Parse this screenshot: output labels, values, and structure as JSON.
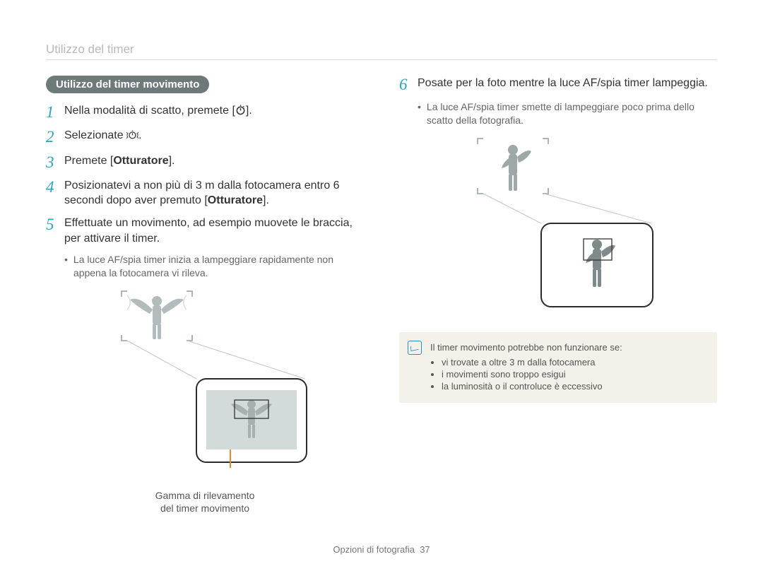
{
  "header": {
    "title": "Utilizzo del timer"
  },
  "left": {
    "pill": "Utilizzo del timer movimento",
    "steps": [
      {
        "num": "1",
        "html": "Nella modalità di scatto, premete [$TIMER$]."
      },
      {
        "num": "2",
        "html": "Selezionate $MOTION$."
      },
      {
        "num": "3",
        "html": "Premete [<b>Otturatore</b>]."
      },
      {
        "num": "4",
        "html": "Posizionatevi a non più di 3 m dalla fotocamera entro 6 secondi dopo aver premuto [<b>Otturatore</b>]."
      },
      {
        "num": "5",
        "html": "Effettuate un movimento, ad esempio muovete le braccia, per attivare il timer."
      }
    ],
    "sub_bullet_5": "La luce AF/spia timer inizia a lampeggiare rapidamente non appena la fotocamera vi rileva.",
    "caption_line1": "Gamma di rilevamento",
    "caption_line2": "del timer movimento"
  },
  "right": {
    "step6_num": "6",
    "step6_text": "Posate per la foto mentre la luce AF/spia timer lampeggia.",
    "sub_bullet_6": "La luce AF/spia timer smette di lampeggiare poco prima dello scatto della fotografia.",
    "note_title": "Il timer movimento potrebbe non funzionare se:",
    "note_items": [
      "vi trovate a oltre 3 m dalla fotocamera",
      "i movimenti sono troppo esigui",
      "la luminosità o il controluce è eccessivo"
    ]
  },
  "footer": {
    "section": "Opzioni di fotografia",
    "page": "37"
  },
  "icons": {
    "timer": "timer-icon",
    "motion": "motion-timer-icon",
    "note": "note-icon"
  }
}
